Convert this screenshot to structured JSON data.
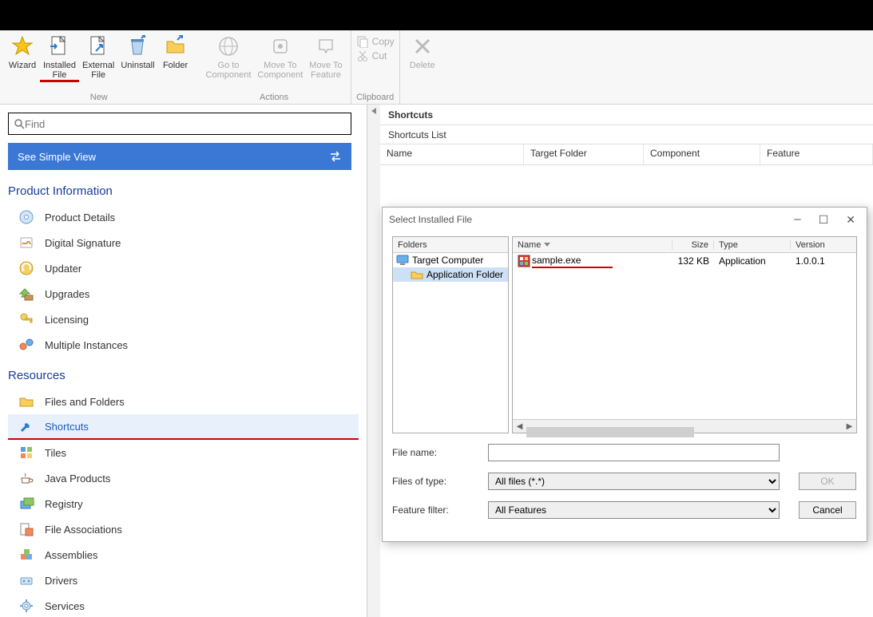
{
  "ribbon": {
    "wizard": "Wizard",
    "installed_file": "Installed\nFile",
    "external_file": "External\nFile",
    "uninstall": "Uninstall",
    "folder": "Folder",
    "group_new": "New",
    "goto_component": "Go to\nComponent",
    "moveto_component": "Move To\nComponent",
    "moveto_feature": "Move To\nFeature",
    "group_actions": "Actions",
    "copy": "Copy",
    "cut": "Cut",
    "group_clipboard": "Clipboard",
    "delete": "Delete"
  },
  "search_placeholder": "Find",
  "simple_view": "See Simple View",
  "nav": {
    "product_info": "Product Information",
    "product_details": "Product Details",
    "digital_signature": "Digital Signature",
    "updater": "Updater",
    "upgrades": "Upgrades",
    "licensing": "Licensing",
    "multiple_instances": "Multiple Instances",
    "resources": "Resources",
    "files_folders": "Files and Folders",
    "shortcuts": "Shortcuts",
    "tiles": "Tiles",
    "java_products": "Java Products",
    "registry": "Registry",
    "file_assoc": "File Associations",
    "assemblies": "Assemblies",
    "drivers": "Drivers",
    "services": "Services"
  },
  "right": {
    "header": "Shortcuts",
    "subheader": "Shortcuts List",
    "cols": {
      "name": "Name",
      "target": "Target Folder",
      "component": "Component",
      "feature": "Feature"
    }
  },
  "dialog": {
    "title": "Select Installed File",
    "folders_header": "Folders",
    "files_cols": {
      "name": "Name",
      "size": "Size",
      "type": "Type",
      "version": "Version"
    },
    "tree": {
      "root": "Target Computer",
      "child": "Application Folder"
    },
    "file": {
      "name": "sample.exe",
      "size": "132 KB",
      "type": "Application",
      "version": "1.0.0.1"
    },
    "filename_label": "File name:",
    "filetype_label": "Files of type:",
    "filetype_value": "All files (*.*)",
    "featurefilter_label": "Feature filter:",
    "featurefilter_value": "All Features",
    "ok": "OK",
    "cancel": "Cancel"
  }
}
